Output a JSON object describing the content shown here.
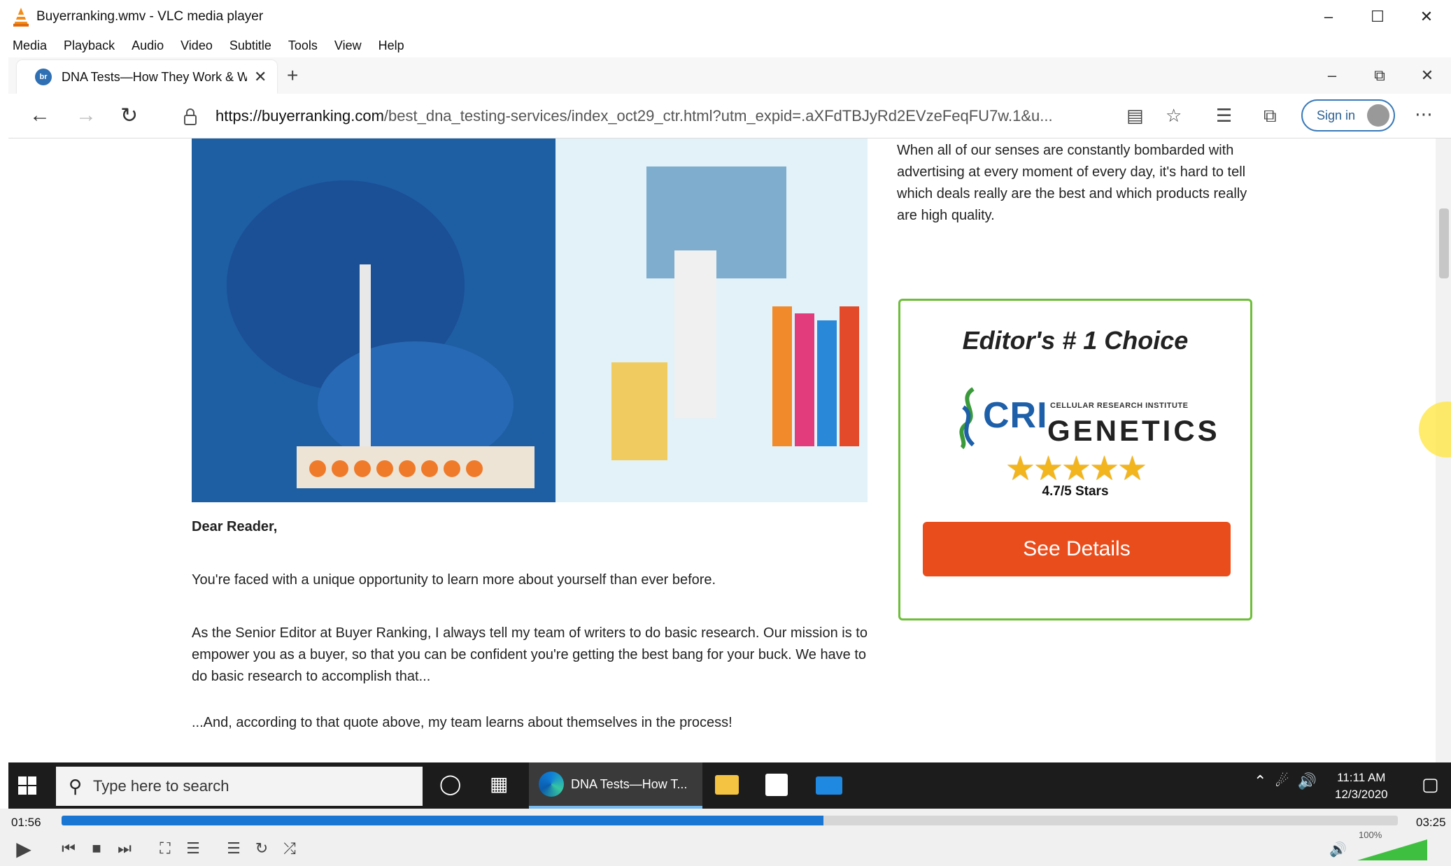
{
  "vlc": {
    "title": "Buyerranking.wmv - VLC media player",
    "menu": [
      "Media",
      "Playback",
      "Audio",
      "Video",
      "Subtitle",
      "Tools",
      "View",
      "Help"
    ],
    "time_current": "01:56",
    "time_total": "03:25",
    "progress_fraction": 0.57,
    "volume_label": "100%"
  },
  "browser": {
    "tab_title": "DNA Tests—How They Work & W",
    "url_domain": "https://buyerranking.com",
    "url_path": "/best_dna_testing-services/index_oct29_ctr.html?utm_expid=.aXFdTBJyRd2EVzeFeqFU7w.1&u...",
    "sign_in_label": "Sign in"
  },
  "page": {
    "intro_text": "When all of our senses are constantly bombarded with advertising at every moment of every day, it's hard to tell which deals really are the best and which products really are high quality.",
    "choice_title": "Editor's # 1 Choice",
    "logo_main": "CRI",
    "logo_genetics": "GENETICS",
    "logo_sub": "CELLULAR RESEARCH INSTITUTE",
    "stars": "★★★★★",
    "rating_text": "4.7/5 Stars",
    "details_button": "See Details",
    "greeting": "Dear Reader,",
    "para1": "You're faced with a unique opportunity to learn more about yourself than ever before.",
    "para2": "As the Senior Editor at Buyer Ranking, I always tell my team of writers to do basic research. Our mission is to empower you as a buyer, so that you can be confident you're getting the best bang for your buck. We have to do basic research to accomplish that...",
    "para3": "...And, according to that quote above, my team learns about themselves in the process!"
  },
  "taskbar": {
    "search_placeholder": "Type here to search",
    "edge_task_label": "DNA Tests—How T...",
    "time": "11:11 AM",
    "date": "12/3/2020"
  }
}
